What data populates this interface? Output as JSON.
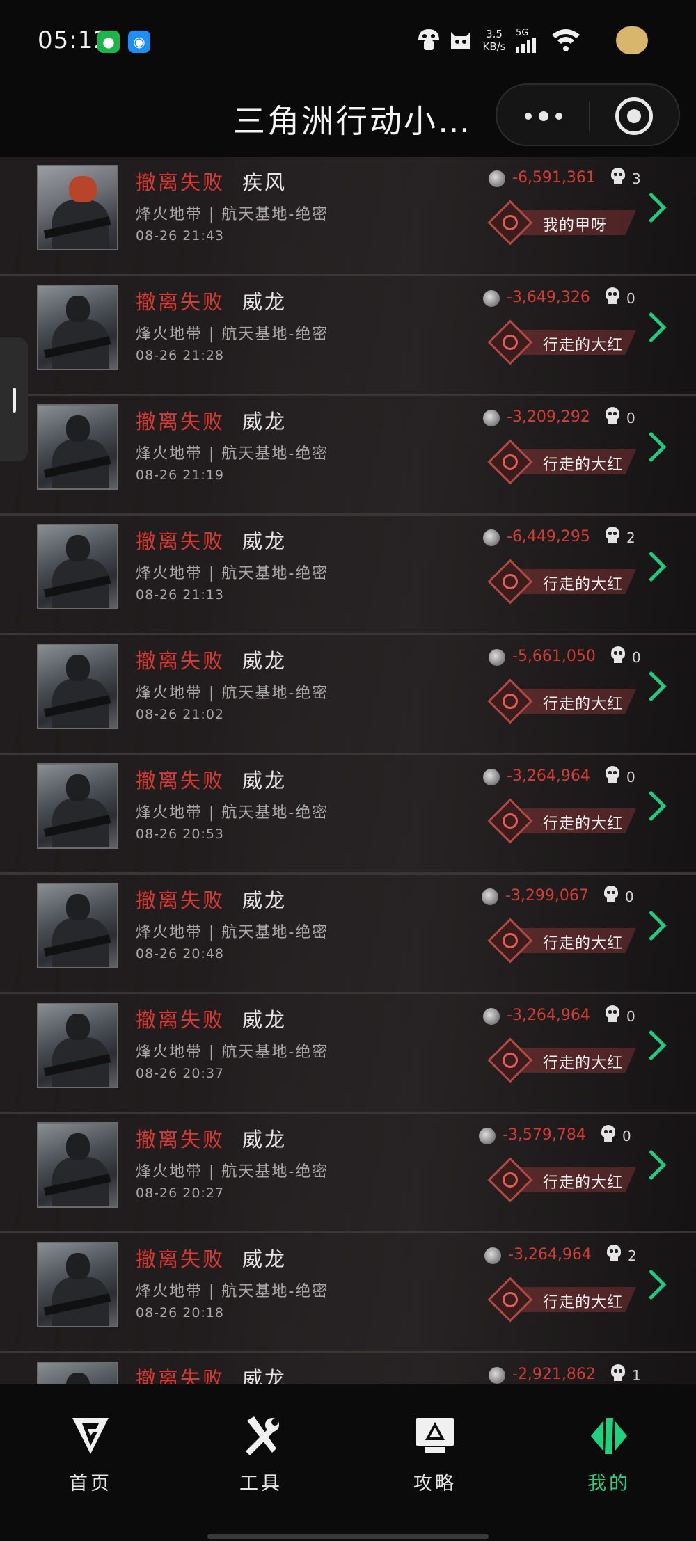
{
  "status_bar": {
    "time": "05:12",
    "net_speed_value": "3.5",
    "net_speed_unit": "KB/s",
    "net_type": "5G",
    "icons": [
      "wechat-icon",
      "qq-icon",
      "mushroom-icon",
      "cat-icon",
      "signal-icon",
      "wifi-icon",
      "avatar-icon"
    ]
  },
  "header": {
    "title": "三角洲行动小…"
  },
  "matches": [
    {
      "status": "撤离失败",
      "operator": "疾风",
      "map": "烽火地带 | 航天基地-绝密",
      "time": "08-26 21:43",
      "value": "-6,591,361",
      "kills": "3",
      "player": "我的甲呀",
      "avatar": "female"
    },
    {
      "status": "撤离失败",
      "operator": "威龙",
      "map": "烽火地带 | 航天基地-绝密",
      "time": "08-26 21:28",
      "value": "-3,649,326",
      "kills": "0",
      "player": "行走的大红",
      "avatar": "male"
    },
    {
      "status": "撤离失败",
      "operator": "威龙",
      "map": "烽火地带 | 航天基地-绝密",
      "time": "08-26 21:19",
      "value": "-3,209,292",
      "kills": "0",
      "player": "行走的大红",
      "avatar": "male"
    },
    {
      "status": "撤离失败",
      "operator": "威龙",
      "map": "烽火地带 | 航天基地-绝密",
      "time": "08-26 21:13",
      "value": "-6,449,295",
      "kills": "2",
      "player": "行走的大红",
      "avatar": "male"
    },
    {
      "status": "撤离失败",
      "operator": "威龙",
      "map": "烽火地带 | 航天基地-绝密",
      "time": "08-26 21:02",
      "value": "-5,661,050",
      "kills": "0",
      "player": "行走的大红",
      "avatar": "male"
    },
    {
      "status": "撤离失败",
      "operator": "威龙",
      "map": "烽火地带 | 航天基地-绝密",
      "time": "08-26 20:53",
      "value": "-3,264,964",
      "kills": "0",
      "player": "行走的大红",
      "avatar": "male"
    },
    {
      "status": "撤离失败",
      "operator": "威龙",
      "map": "烽火地带 | 航天基地-绝密",
      "time": "08-26 20:48",
      "value": "-3,299,067",
      "kills": "0",
      "player": "行走的大红",
      "avatar": "male"
    },
    {
      "status": "撤离失败",
      "operator": "威龙",
      "map": "烽火地带 | 航天基地-绝密",
      "time": "08-26 20:37",
      "value": "-3,264,964",
      "kills": "0",
      "player": "行走的大红",
      "avatar": "male"
    },
    {
      "status": "撤离失败",
      "operator": "威龙",
      "map": "烽火地带 | 航天基地-绝密",
      "time": "08-26 20:27",
      "value": "-3,579,784",
      "kills": "0",
      "player": "行走的大红",
      "avatar": "male"
    },
    {
      "status": "撤离失败",
      "operator": "威龙",
      "map": "烽火地带 | 航天基地-绝密",
      "time": "08-26 20:18",
      "value": "-3,264,964",
      "kills": "2",
      "player": "行走的大红",
      "avatar": "male"
    },
    {
      "status": "撤离失败",
      "operator": "威龙",
      "map": "",
      "time": "",
      "value": "-2,921,862",
      "kills": "1",
      "player": "",
      "avatar": "male"
    }
  ],
  "bottom_nav": {
    "items": [
      {
        "label": "首页",
        "icon": "home-logo-icon"
      },
      {
        "label": "工具",
        "icon": "tools-icon"
      },
      {
        "label": "攻略",
        "icon": "guide-monitor-icon"
      },
      {
        "label": "我的",
        "icon": "profile-logo-icon",
        "active": true
      }
    ]
  },
  "colors": {
    "fail_red": "#d53a33",
    "accent_green": "#22d17f"
  }
}
